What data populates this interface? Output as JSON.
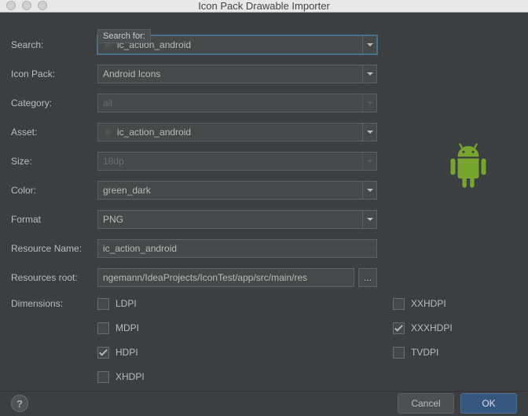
{
  "window": {
    "title": "Icon Pack Drawable Importer"
  },
  "tooltip": "Search for:",
  "labels": {
    "search": "Search:",
    "iconpack": "Icon Pack:",
    "category": "Category:",
    "asset": "Asset:",
    "size": "Size:",
    "color": "Color:",
    "format": "Format",
    "resname": "Resource Name:",
    "resroot": "Resources root:",
    "dimensions": "Dimensions:"
  },
  "fields": {
    "search": "ic_action_android",
    "iconpack": "Android Icons",
    "category": "all",
    "asset": "ic_action_android",
    "size": "18dp",
    "color": "green_dark",
    "format": "PNG",
    "resname": "ic_action_android",
    "resroot": "ngemann/IdeaProjects/IconTest/app/src/main/res",
    "browse": "..."
  },
  "dimensions": {
    "col1": [
      {
        "label": "LDPI",
        "checked": false
      },
      {
        "label": "MDPI",
        "checked": false
      },
      {
        "label": "HDPI",
        "checked": true
      },
      {
        "label": "XHDPI",
        "checked": false
      }
    ],
    "col2": [
      {
        "label": "XXHDPI",
        "checked": false
      },
      {
        "label": "XXXHDPI",
        "checked": true
      },
      {
        "label": "TVDPI",
        "checked": false
      }
    ]
  },
  "footer": {
    "help": "?",
    "cancel": "Cancel",
    "ok": "OK"
  },
  "colors": {
    "android": "#78a52d"
  }
}
